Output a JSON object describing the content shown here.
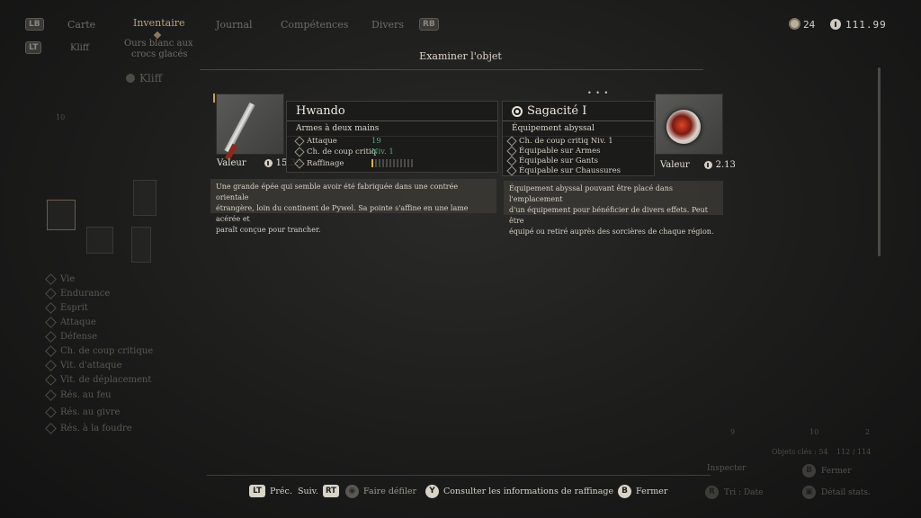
{
  "nav": {
    "lb": "LB",
    "rb": "RB",
    "lt": "LT",
    "tabs": [
      "Carte",
      "Inventaire",
      "Journal",
      "Compétences",
      "Divers"
    ],
    "subtabs": [
      "Kliff",
      "Ours blanc aux",
      "crocs glacés"
    ],
    "character": "Kliff"
  },
  "currency": {
    "skull_count": "24",
    "coins": "111.99"
  },
  "modal": {
    "title": "Examiner l'objet",
    "page_dots": "• • •"
  },
  "weapon": {
    "name": "Hwando",
    "type": "Armes à deux mains",
    "value_label": "Valeur",
    "value": "15.39",
    "attributes": [
      {
        "label": "Attaque",
        "value": "19"
      },
      {
        "label": "Ch. de coup critiq",
        "value": "Niv. 1"
      },
      {
        "label": "Raffinage",
        "value": ""
      }
    ],
    "refine_level": 1,
    "refine_max": 12,
    "description_lines": [
      "Une grande épée qui semble avoir été fabriquée dans une contrée orientale",
      "étrangère, loin du continent de Pywel. Sa pointe s'affine en une lame acérée et",
      "paraît conçue pour trancher."
    ]
  },
  "gear": {
    "name": "Sagacité I",
    "type": "Équipement abyssal",
    "value_label": "Valeur",
    "value": "2.13",
    "attributes": [
      "Ch. de coup critiq Niv. 1",
      "Équipable sur Armes",
      "Équipable sur Gants",
      "Équipable sur Chaussures"
    ],
    "description_lines": [
      "Équipement abyssal pouvant être placé dans l'emplacement",
      "d'un équipement pour bénéficier de divers effets. Peut être",
      "équipé ou retiré auprès des sorcières de chaque région."
    ]
  },
  "stats": [
    "Vie",
    "Endurance",
    "Esprit",
    "Attaque",
    "Défense",
    "Ch. de coup critique",
    "Vit. d'attaque",
    "Vit. de déplacement",
    "Rés. au feu",
    "Rés. au givre",
    "Rés. à la foudre"
  ],
  "bg_right": {
    "counts": [
      "9",
      "10",
      "2"
    ],
    "objets_label": "Objets clés : 54",
    "objets_count": "112 / 114",
    "inspect": "Inspecter",
    "close": "Fermer",
    "sort": "Tri : Date",
    "detail": "Détail stats.",
    "slot_count": "10"
  },
  "controls": {
    "prev_key": "LT",
    "prev": "Préc.",
    "next": "Suiv.",
    "next_key": "RT",
    "scroll": "Faire défiler",
    "refine_key": "Y",
    "refine": "Consulter les informations de raffinage",
    "close_key": "B",
    "close": "Fermer"
  }
}
